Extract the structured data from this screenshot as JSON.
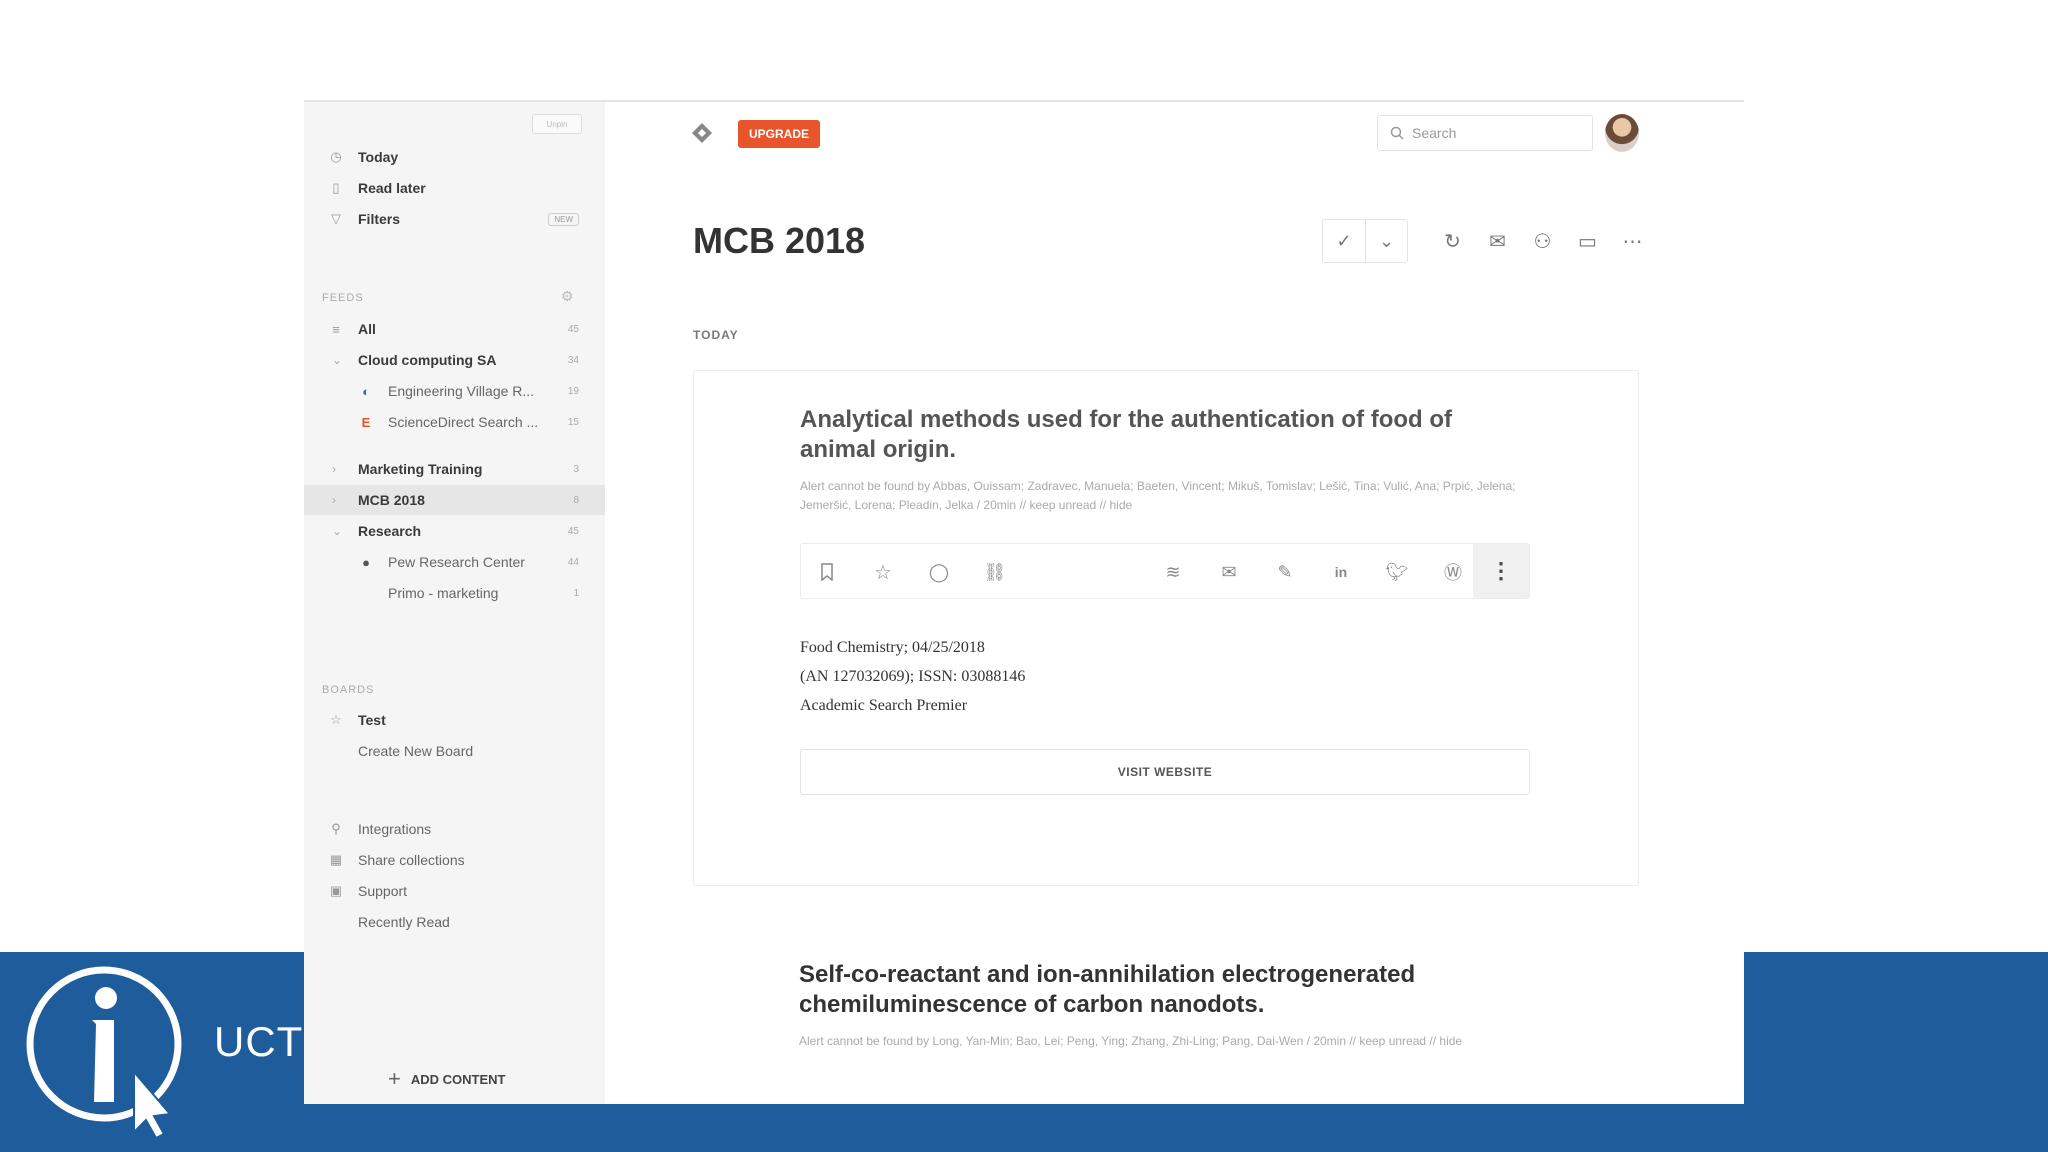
{
  "branding": {
    "org": "UCT"
  },
  "sidebar": {
    "collapse_label": "Unpin",
    "top_items": [
      {
        "label": "Today",
        "icon": "clock-icon"
      },
      {
        "label": "Read later",
        "icon": "bookmark-icon"
      },
      {
        "label": "Filters",
        "icon": "filter-icon",
        "badge": "NEW"
      }
    ],
    "feeds_header": "FEEDS",
    "feeds": [
      {
        "label": "All",
        "count": "45"
      },
      {
        "label": "Cloud computing SA",
        "count": "34",
        "expanded": true
      },
      {
        "label": "Engineering Village R...",
        "count": "19",
        "child": true
      },
      {
        "label": "ScienceDirect Search ...",
        "count": "15",
        "child": true
      },
      {
        "label": "Marketing Training",
        "count": "3"
      },
      {
        "label": "MCB 2018",
        "count": "8",
        "active": true
      },
      {
        "label": "Research",
        "count": "45",
        "expanded": true
      },
      {
        "label": "Pew Research Center",
        "count": "44",
        "child": true
      },
      {
        "label": "Primo - marketing",
        "count": "1",
        "child": true
      }
    ],
    "boards_header": "BOARDS",
    "boards": [
      {
        "label": "Test"
      },
      {
        "label": "Create New Board"
      }
    ],
    "bottom_items": [
      {
        "label": "Integrations"
      },
      {
        "label": "Share collections"
      },
      {
        "label": "Support"
      },
      {
        "label": "Recently Read"
      }
    ],
    "add_content": "ADD CONTENT"
  },
  "header": {
    "upgrade_label": "UPGRADE",
    "search_placeholder": "Search"
  },
  "main": {
    "title": "MCB 2018",
    "section_label": "TODAY",
    "articles": [
      {
        "title": "Analytical methods used for the authentication of food of animal origin.",
        "meta": "Alert cannot be found by Abbas, Ouissam; Zadravec, Manuela; Baeten, Vincent; Mikuš, Tomislav; Lešić, Tina; Vulić, Ana; Prpić, Jelena; Jemeršić, Lorena; Pleadin, Jelka / 20min // keep unread // hide",
        "body_lines": [
          "Food Chemistry; 04/25/2018",
          "(AN 127032069); ISSN: 03088146",
          "Academic Search Premier"
        ],
        "visit_label": "VISIT WEBSITE"
      },
      {
        "title": "Self-co-reactant and ion-annihilation electrogenerated chemiluminescence of carbon nanodots.",
        "meta": "Alert cannot be found by Long, Yan-Min; Bao, Lei; Peng, Ying; Zhang, Zhi-Ling; Pang, Dai-Wen / 20min // keep unread // hide"
      }
    ]
  }
}
